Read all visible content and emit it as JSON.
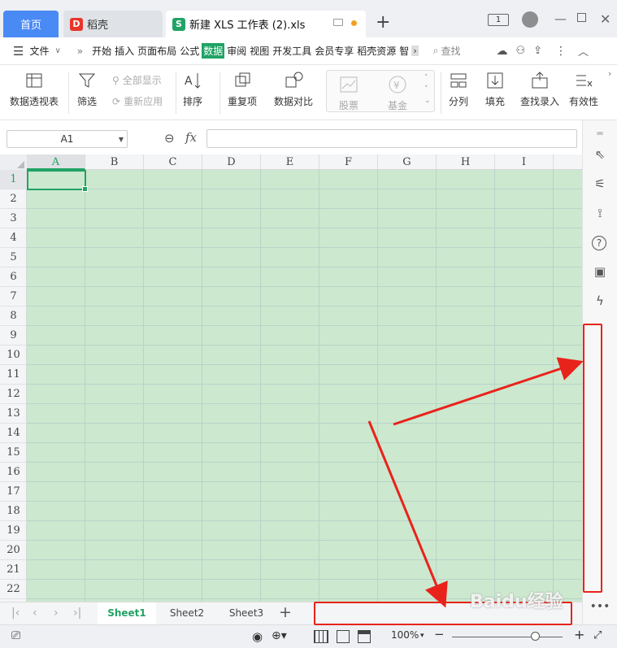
{
  "tabs": {
    "home": "首页",
    "daoke": "稻壳",
    "doc": "新建 XLS 工作表 (2).xls",
    "add": "+"
  },
  "menu": {
    "file": "文件",
    "items": [
      "开始",
      "插入",
      "页面布局",
      "公式",
      "数据",
      "审阅",
      "视图",
      "开发工具",
      "会员专享",
      "稻壳资源",
      "智"
    ],
    "active_index": 4,
    "search": "查找"
  },
  "ribbon": {
    "pivot": "数据透视表",
    "filter": "筛选",
    "show_all": "全部显示",
    "reapply": "重新应用",
    "sort": "排序",
    "duplicates": "重复项",
    "compare": "数据对比",
    "stock": "股票",
    "fund": "基金",
    "split": "分列",
    "fill": "填充",
    "lookup": "查找录入",
    "validity": "有效性"
  },
  "formula": {
    "namebox": "A1",
    "fx": "fx"
  },
  "grid": {
    "columns": [
      "A",
      "B",
      "C",
      "D",
      "E",
      "F",
      "G",
      "H",
      "I"
    ],
    "rows": [
      "1",
      "2",
      "3",
      "4",
      "5",
      "6",
      "7",
      "8",
      "9",
      "10",
      "11",
      "12",
      "13",
      "14",
      "15",
      "16",
      "17",
      "18",
      "19",
      "20",
      "21",
      "22"
    ],
    "selected_cell": "A1"
  },
  "sheets": {
    "tabs": [
      "Sheet1",
      "Sheet2",
      "Sheet3"
    ],
    "active": "Sheet1"
  },
  "status": {
    "zoom": "100%",
    "zoom_level": 0.75
  },
  "watermark": "Baidu经验",
  "colors": {
    "accent": "#21a366",
    "tab_blue": "#4a8af4",
    "grid_fill": "#cce8cf",
    "annotation_red": "#e8231b"
  }
}
